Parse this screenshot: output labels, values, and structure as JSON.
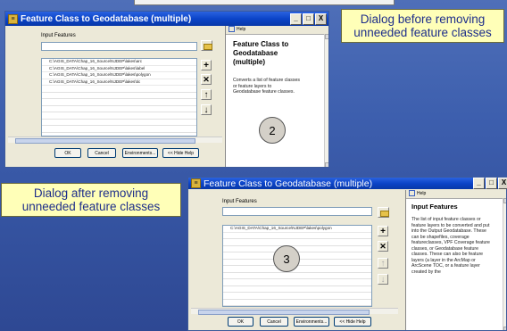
{
  "callouts": {
    "before": "Dialog before removing unneeded feature classes",
    "after": "Dialog after removing unneeded feature classes"
  },
  "dialog1": {
    "title": "Feature Class to Geodatabase (multiple)",
    "input_label": "Input Features",
    "items": [
      "C:\\AGIS_DATA\\Chap_16_Source\\NJDEP\\lakes\\arc",
      "C:\\AGIS_DATA\\Chap_16_Source\\NJDEP\\lakes\\label",
      "C:\\AGIS_DATA\\Chap_16_Source\\NJDEP\\lakes\\polygon",
      "C:\\AGIS_DATA\\Chap_16_Source\\NJDEP\\lakes\\tic"
    ],
    "buttons": {
      "ok": "OK",
      "cancel": "Cancel",
      "environments": "Environments...",
      "hide_help": "<< Hide Help"
    },
    "help": {
      "tab": "Help",
      "title": "Feature Class to Geodatabase (multiple)",
      "text": "Converts a list of feature classes or feature layers to Geodatabase feature classes."
    },
    "badge": "2",
    "window_buttons": {
      "min": "_",
      "max": "□",
      "close": "X"
    }
  },
  "dialog2": {
    "title": "Feature Class to Geodatabase (multiple)",
    "input_label": "Input Features",
    "items": [
      "C:\\AGIS_DATA\\Chap_16_Source\\NJDEP\\lakes\\polygon"
    ],
    "buttons": {
      "ok": "OK",
      "cancel": "Cancel",
      "environments": "Environments...",
      "hide_help": "<< Hide Help"
    },
    "help": {
      "tab": "Help",
      "title": "Input Features",
      "text": "The list of input feature classes or feature layers to be converted and put into the Output Geodatabase. These can be shapefiles, coverage featureclasses, VPF Coverage feature classes, or Geodatabase feature classes. These can also be feature layers (a layer in the ArcMap or ArcScene TOC, or a feature layer created by the"
    },
    "badge": "3",
    "window_buttons": {
      "min": "_",
      "max": "□",
      "close": "X"
    }
  },
  "icons": {
    "add": "+",
    "remove": "✕",
    "up": "↑",
    "down": "↓"
  }
}
